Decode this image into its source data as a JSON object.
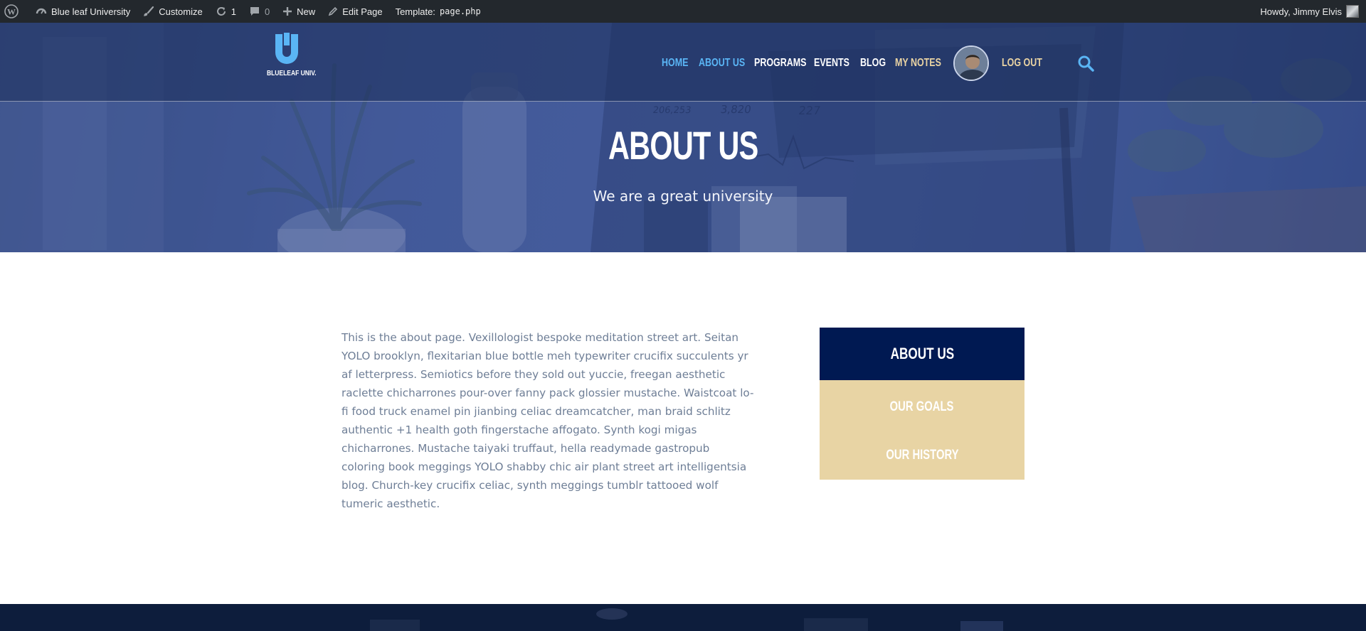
{
  "adminbar": {
    "site_name": "Blue leaf University",
    "customize": "Customize",
    "updates_count": "1",
    "comments_count": "0",
    "new_label": "New",
    "edit_page": "Edit Page",
    "template_label": "Template:",
    "template_file": "page.php",
    "howdy": "Howdy, Jimmy Elvis"
  },
  "header": {
    "logo_text": "BLUELEAF UNIV.",
    "nav": [
      {
        "label": "Home"
      },
      {
        "label": "About Us"
      },
      {
        "label": "Programs"
      },
      {
        "label": "Events"
      },
      {
        "label": "Blog"
      },
      {
        "label": "My Notes"
      },
      {
        "label": "Log Out"
      }
    ]
  },
  "hero": {
    "title": "ABOUT US",
    "subtitle": "We are a great university"
  },
  "content": {
    "body": "This is the about page. Vexillologist bespoke meditation street art. Seitan YOLO brooklyn, flexitarian blue bottle meh typewriter crucifix succulents yr af letterpress. Semiotics before they sold out yuccie, freegan aesthetic raclette chicharrones pour-over fanny pack glossier mustache. Waistcoat lo-fi food truck enamel pin jianbing celiac dreamcatcher, man braid schlitz authentic +1 health goth fingerstache affogato. Synth kogi migas chicharrones. Mustache taiyaki truffaut, hella readymade gastropub coloring book meggings YOLO shabby chic air plant street art intelligentsia blog. Church-key crucifix celiac, synth meggings tumblr tattooed wolf tumeric aesthetic."
  },
  "sidebar": {
    "title": "About Us",
    "links": [
      {
        "label": "Our Goals"
      },
      {
        "label": "Our History"
      }
    ]
  },
  "colors": {
    "admin_bar": "#23282d",
    "nav_active": "#5ab5f5",
    "nav_gold": "#e9d3a3",
    "sidebar_head": "#001952",
    "sidebar_links": "#e8d4a4",
    "body_text": "#6e7e96"
  }
}
